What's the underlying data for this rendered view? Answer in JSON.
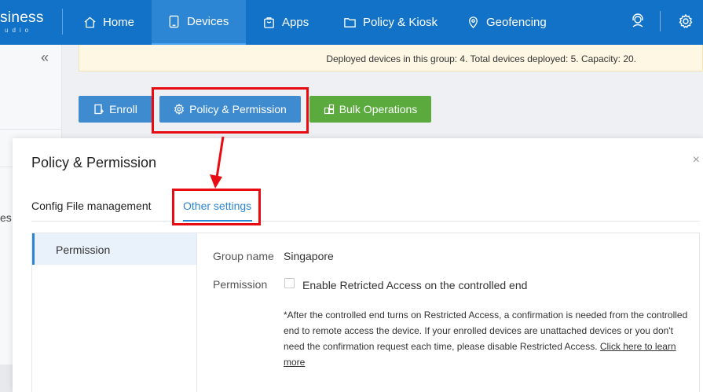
{
  "header": {
    "brand": "siness",
    "brand_sub": "udio",
    "nav": [
      {
        "label": "Home",
        "icon": "home-icon"
      },
      {
        "label": "Devices",
        "icon": "tablet-icon",
        "active": true
      },
      {
        "label": "Apps",
        "icon": "shopping-bag-icon"
      },
      {
        "label": "Policy & Kiosk",
        "icon": "folder-icon"
      },
      {
        "label": "Geofencing",
        "icon": "location-pin-icon"
      }
    ],
    "right_icons": [
      "support-agent-icon",
      "gear-icon"
    ]
  },
  "sidebar": {
    "collapse_glyph": "«",
    "partial_text": "es"
  },
  "notice": {
    "text": "Deployed devices in this group: 4. Total devices deployed: 5. Capacity: 20."
  },
  "actions": {
    "enroll": "Enroll",
    "policy": "Policy & Permission",
    "bulk": "Bulk Operations"
  },
  "modal": {
    "title": "Policy & Permission",
    "close": "×",
    "tabs": [
      {
        "label": "Config File management",
        "active": false
      },
      {
        "label": "Other settings",
        "active": true
      }
    ],
    "menu": [
      {
        "label": "Permission",
        "active": true
      }
    ],
    "form": {
      "group_label": "Group name",
      "group_value": "Singapore",
      "permission_label": "Permission",
      "checkbox_label": "Enable Retricted Access on the controlled end",
      "checkbox_checked": false,
      "note": "*After the controlled end turns on Restricted Access, a confirmation is needed from the controlled end to remote access the device. If your enrolled devices are unattached devices or you don't need the confirmation request each time, please disable Restricted Access. ",
      "note_link": "Click here to learn more"
    }
  },
  "colors": {
    "header": "#1172c7",
    "accent": "#2d86d3",
    "primary_button": "#3f8bd0",
    "success_button": "#5aaa3d",
    "annotation": "#e80c12"
  }
}
